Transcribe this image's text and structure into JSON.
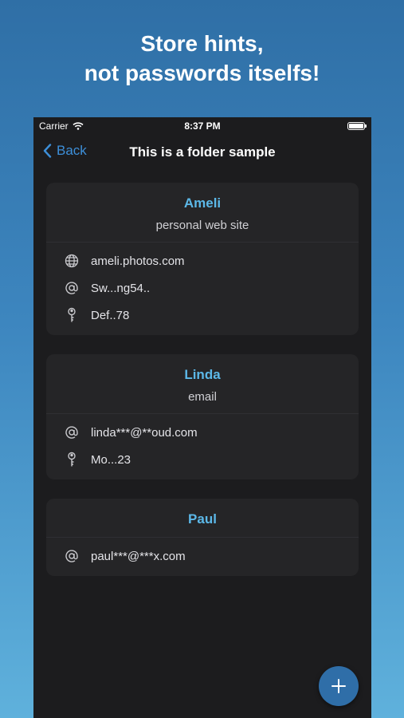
{
  "headline": {
    "line1": "Store hints,",
    "line2": "not passwords itselfs!"
  },
  "statusbar": {
    "carrier": "Carrier",
    "time": "8:37 PM"
  },
  "navbar": {
    "back_label": "Back",
    "title": "This is a folder sample"
  },
  "entries": [
    {
      "name": "Ameli",
      "description": "personal web site",
      "rows": [
        {
          "icon": "globe-icon",
          "value": "ameli.photos.com"
        },
        {
          "icon": "at-icon",
          "value": "Sw...ng54.."
        },
        {
          "icon": "key-icon",
          "value": "Def..78"
        }
      ]
    },
    {
      "name": "Linda",
      "description": "email",
      "rows": [
        {
          "icon": "at-icon",
          "value": "linda***@**oud.com"
        },
        {
          "icon": "key-icon",
          "value": "Mo...23"
        }
      ]
    },
    {
      "name": "Paul",
      "description": "",
      "rows": [
        {
          "icon": "at-icon",
          "value": "paul***@***x.com"
        }
      ]
    }
  ],
  "fab": {
    "icon": "plus-icon"
  },
  "colors": {
    "accent": "#5cb8e8",
    "link": "#3d8fd9",
    "fab": "#2f6ea8",
    "card": "#252527",
    "screen": "#1c1c1e"
  }
}
